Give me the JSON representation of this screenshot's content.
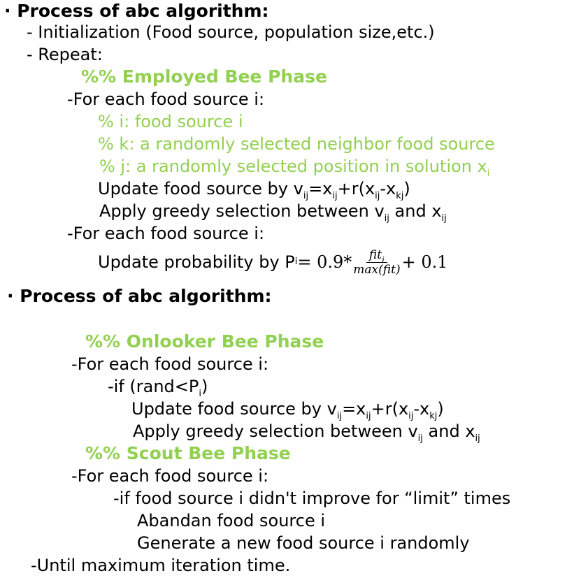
{
  "section1": {
    "heading": "· Process of abc algorithm:",
    "init": "- Initialization (Food source, population size,etc.)",
    "repeat": "- Repeat:",
    "employed_title": "%% Employed Bee Phase",
    "for_each_1": "-For each food source i:",
    "comment_i": "% i: food source i",
    "comment_k": "% k: a randomly selected neighbor food source",
    "comment_j": "% j: a randomly selected position in solution x",
    "comment_j_sub": "i",
    "update_prefix": "Update food source by v",
    "greedy_prefix": "Apply greedy selection between v",
    "greedy_and": " and x",
    "sub_ij": "ij",
    "sub_kj": "kj",
    "for_each_2": "-For each food source i:",
    "prob_prefix": "Update probability by P",
    "prob_sub": "i",
    "prob_eq": " = 0.9*",
    "prob_num": "fit",
    "prob_num_sub": "i",
    "prob_den": "max(fit)",
    "prob_tail": "+ 0.1"
  },
  "section2": {
    "heading": "· Process of abc algorithm:",
    "onlooker_title": "%% Onlooker Bee Phase",
    "for_each": "-For each food source i:",
    "if_rand": "-if (rand<P",
    "if_rand_sub": "i",
    "if_rand_close": ")",
    "scout_title": "%% Scout Bee Phase",
    "for_each_2": "-For each food source i:",
    "if_limit": "-if food source i didn't improve for “limit” times",
    "abandon": "Abandan food source i",
    "generate": "Generate a new food source i randomly",
    "until": "-Until maximum iteration time."
  }
}
